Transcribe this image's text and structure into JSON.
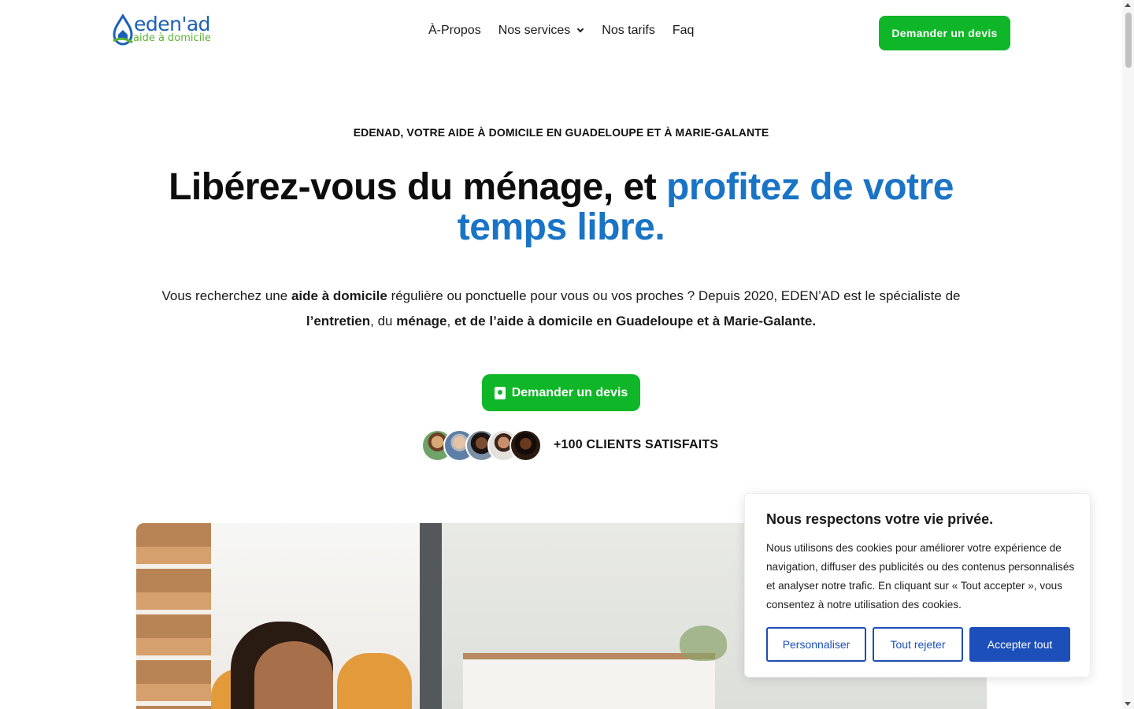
{
  "brand": {
    "name": "eden'ad",
    "tagline": "aide à domicile",
    "colors": {
      "primary_blue": "#1a74c6",
      "green": "#0fb628",
      "cookie_blue": "#1c4fb9"
    }
  },
  "nav": {
    "items": [
      {
        "label": "À-Propos"
      },
      {
        "label": "Nos services",
        "has_dropdown": true
      },
      {
        "label": "Nos tarifs"
      },
      {
        "label": "Faq"
      }
    ],
    "cta_label": "Demander un devis"
  },
  "hero": {
    "eyebrow": "EDENAD, VOTRE AIDE À DOMICILE EN GUADELOUPE ET À MARIE-GALANTE",
    "headline_part1": "Libérez-vous du ménage, et ",
    "headline_part2": "profitez de votre temps libre.",
    "intro": {
      "t1": "Vous recherchez une ",
      "b1": "aide à domicile",
      "t2": " régulière ou ponctuelle pour vous ou vos proches ? Depuis 2020, EDEN’AD est le spécialiste de ",
      "b2": "l’entretien",
      "t3": ", du ",
      "b3": "ménage",
      "t4": ", ",
      "b4": "et de l’aide à domicile en Guadeloupe et à Marie-Galante."
    },
    "cta_label": "Demander un devis",
    "cta_icon": "contact-card-icon",
    "social_proof": "+100 CLIENTS SATISFAITS"
  },
  "cookie": {
    "title": "Nous respectons votre vie privée.",
    "text": "Nous utilisons des cookies pour améliorer votre expérience de navigation, diffuser des publicités ou des contenus personnalisés et analyser notre trafic. En cliquant sur « Tout accepter », vous consentez à notre utilisation des cookies.",
    "btn_customize": "Personnaliser",
    "btn_reject": "Tout rejeter",
    "btn_accept": "Accepter tout"
  }
}
